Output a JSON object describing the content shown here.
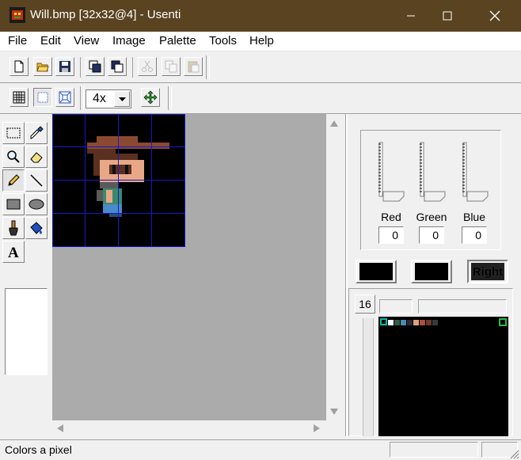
{
  "window": {
    "title": "Will.bmp [32x32@4] - Usenti"
  },
  "menu": [
    "File",
    "Edit",
    "View",
    "Image",
    "Palette",
    "Tools",
    "Help"
  ],
  "toolbar2": {
    "zoom": "4x"
  },
  "tools": [
    "select-rect",
    "eyedropper",
    "zoom",
    "eraser",
    "pencil",
    "line",
    "rectangle",
    "ellipse",
    "brush",
    "fill",
    "text"
  ],
  "color_panel": {
    "labels": {
      "red": "Red",
      "green": "Green",
      "blue": "Blue"
    },
    "values": {
      "red": "0",
      "green": "0",
      "blue": "0"
    },
    "right_label": "Right"
  },
  "palette": {
    "count": "16",
    "colors": [
      "#000000",
      "#ffffff",
      "#3a5a4a",
      "#4a8aaa",
      "#2a2a3a",
      "#e0a080",
      "#a85040",
      "#6a3a2a",
      "#3a3a3a"
    ],
    "accent_selected": "#00c0a0",
    "accent_right": "#20c040"
  },
  "sprite": {
    "grid_color": "#1818c8",
    "colors": {
      "hat": "#8a4a32",
      "hair": "#5a3020",
      "skin": "#e8a888",
      "eye": "#101010",
      "shirt": "#3a8a70",
      "gray": "#5a5a5a",
      "jeans": "#4a8ac8"
    }
  },
  "status": {
    "text": "Colors a pixel"
  }
}
